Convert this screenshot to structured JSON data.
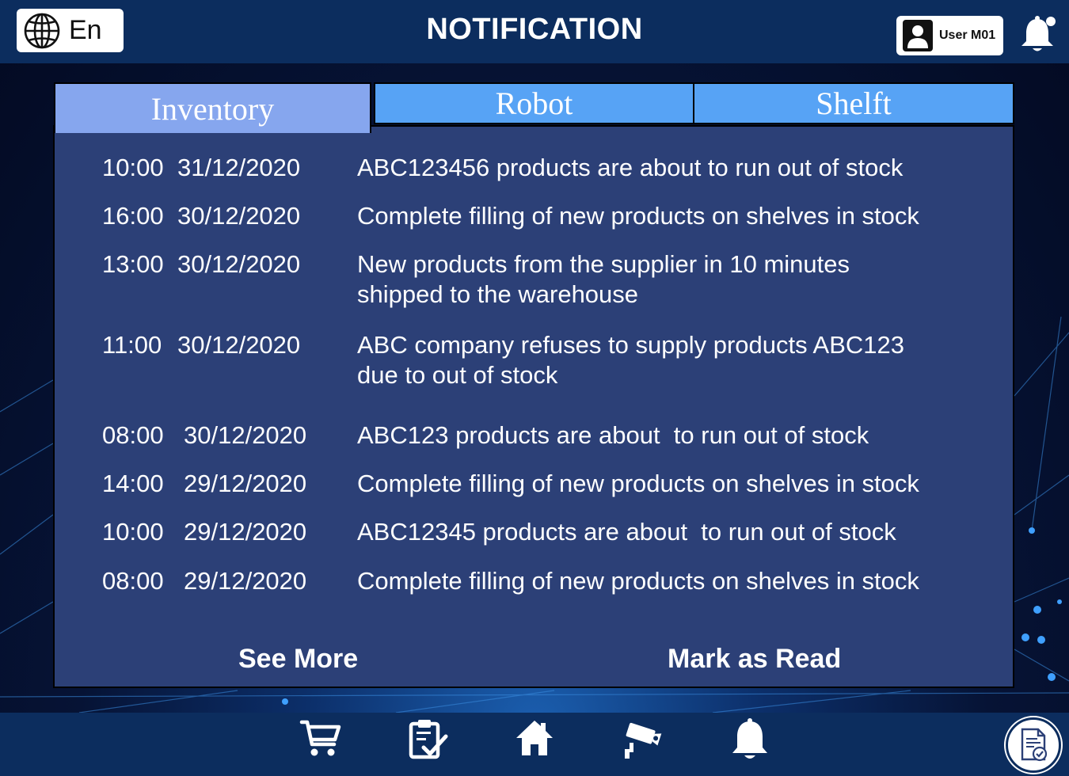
{
  "header": {
    "language_label": "En",
    "title": "NOTIFICATION",
    "user_name": "User M01"
  },
  "tabs": [
    {
      "label": "Inventory",
      "active": true
    },
    {
      "label": "Robot",
      "active": false
    },
    {
      "label": "Shelft",
      "active": false
    }
  ],
  "notifications": [
    {
      "time": "10:00",
      "date": "31/12/2020",
      "message": "ABC123456 products are about to run out of stock"
    },
    {
      "time": "16:00",
      "date": "30/12/2020",
      "message": "Complete filling of new products on shelves in stock"
    },
    {
      "time": "13:00",
      "date": "30/12/2020",
      "message": "New products from the supplier in 10 minutes\nshipped to the warehouse"
    },
    {
      "time": "11:00",
      "date": "30/12/2020",
      "message": "ABC company refuses to supply products ABC123\ndue to out of stock"
    },
    {
      "time": "08:00",
      "date": "30/12/2020",
      "message": "ABC123 products are about  to run out of stock"
    },
    {
      "time": "14:00",
      "date": "29/12/2020",
      "message": "Complete filling of new products on shelves in stock"
    },
    {
      "time": "10:00",
      "date": "29/12/2020",
      "message": "ABC12345 products are about  to run out of stock"
    },
    {
      "time": "08:00",
      "date": "29/12/2020",
      "message": "Complete filling of new products on shelves in stock"
    }
  ],
  "actions": {
    "see_more": "See More",
    "mark_as_read": "Mark as Read"
  },
  "bottom_nav": [
    {
      "icon": "cart-icon"
    },
    {
      "icon": "clipboard-check-icon"
    },
    {
      "icon": "home-icon"
    },
    {
      "icon": "security-camera-icon"
    },
    {
      "icon": "bell-icon"
    }
  ],
  "colors": {
    "bar": "#0c2d5e",
    "panel": "#2c4077",
    "tab_active": "#86a6ee",
    "tab_inactive": "#57a3f5"
  }
}
